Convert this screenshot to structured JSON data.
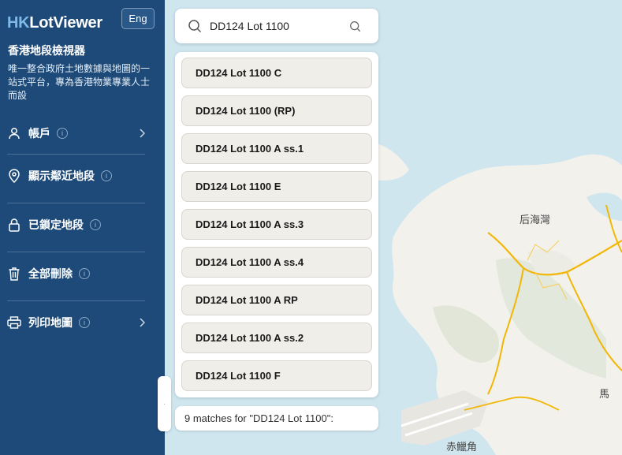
{
  "brand": {
    "prefix": "HK",
    "rest": "LotViewer"
  },
  "lang_button": "Eng",
  "subtitle": "香港地段檢視器",
  "description": "唯一整合政府土地數據與地圖的一站式平台，專為香港物業專業人士而設",
  "menu": [
    {
      "label": "帳戶",
      "icon": "user-icon",
      "has_chevron": true
    },
    {
      "label": "顯示鄰近地段",
      "icon": "location-pin-icon",
      "has_chevron": false
    },
    {
      "label": "已鎖定地段",
      "icon": "lock-icon",
      "has_chevron": false
    },
    {
      "label": "全部刪除",
      "icon": "trash-icon",
      "has_chevron": false
    },
    {
      "label": "列印地圖",
      "icon": "printer-icon",
      "has_chevron": true
    }
  ],
  "info_glyph": "i",
  "search": {
    "value": "DD124 Lot 1100"
  },
  "results": [
    "DD124 Lot 1100 C",
    "DD124 Lot 1100 (RP)",
    "DD124 Lot 1100 A ss.1",
    "DD124 Lot 1100 E",
    "DD124 Lot 1100 A ss.3",
    "DD124 Lot 1100 A ss.4",
    "DD124 Lot 1100 A RP",
    "DD124 Lot 1100 A ss.2",
    "DD124 Lot 1100 F"
  ],
  "matches_text": "9 matches for \"DD124 Lot 1100\":",
  "map_places": {
    "p1": "后海灣",
    "p2": "馬",
    "p3": "赤鱲角"
  },
  "colors": {
    "sidebar": "#1d4a78",
    "sea": "#cfe6ef",
    "land": "#f3f1ec",
    "road": "#f2b705"
  }
}
